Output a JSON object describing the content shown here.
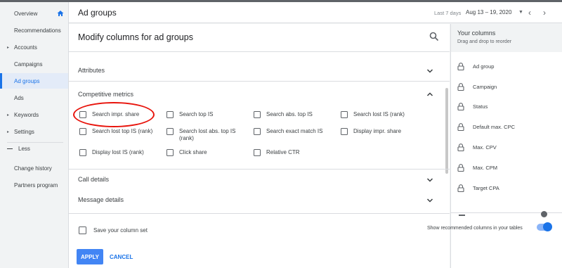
{
  "nav": {
    "items": [
      {
        "label": "Overview"
      },
      {
        "label": "Recommendations"
      },
      {
        "label": "Accounts"
      },
      {
        "label": "Campaigns"
      },
      {
        "label": "Ad groups"
      },
      {
        "label": "Ads"
      },
      {
        "label": "Keywords"
      },
      {
        "label": "Settings"
      }
    ],
    "less_label": "Less",
    "secondary": [
      {
        "label": "Change history"
      },
      {
        "label": "Partners program"
      }
    ]
  },
  "header": {
    "title": "Ad groups",
    "date_label": "Last 7 days",
    "date_range": "Aug 13 – 19, 2020"
  },
  "dialog": {
    "title": "Modify columns for ad groups",
    "sections": {
      "attributes": "Attributes",
      "competitive": "Competitive metrics",
      "call": "Call details",
      "message": "Message details"
    },
    "competitive_options": [
      {
        "label": "Search impr. share"
      },
      {
        "label": "Search top IS"
      },
      {
        "label": "Search abs. top IS"
      },
      {
        "label": "Search lost IS (rank)"
      },
      {
        "label": "Search lost top IS (rank)"
      },
      {
        "label": "Search lost abs. top IS (rank)"
      },
      {
        "label": "Search exact match IS"
      },
      {
        "label": "Display impr. share"
      },
      {
        "label": "Display lost IS (rank)"
      },
      {
        "label": "Click share"
      },
      {
        "label": "Relative CTR"
      }
    ],
    "save_label": "Save your column set",
    "apply_label": "APPLY",
    "cancel_label": "CANCEL"
  },
  "your_columns": {
    "title": "Your columns",
    "subtitle": "Drag and drop to reorder",
    "items": [
      {
        "label": "Ad group"
      },
      {
        "label": "Campaign"
      },
      {
        "label": "Status"
      },
      {
        "label": "Default max. CPC"
      },
      {
        "label": "Max. CPV"
      },
      {
        "label": "Max. CPM"
      },
      {
        "label": "Target CPA"
      }
    ],
    "toggle_label": "Show recommended columns in your tables",
    "toggle_on": true
  },
  "colors": {
    "accent": "#1a73e8",
    "apply_bg": "#4285f4",
    "highlight": "#e8140c"
  }
}
